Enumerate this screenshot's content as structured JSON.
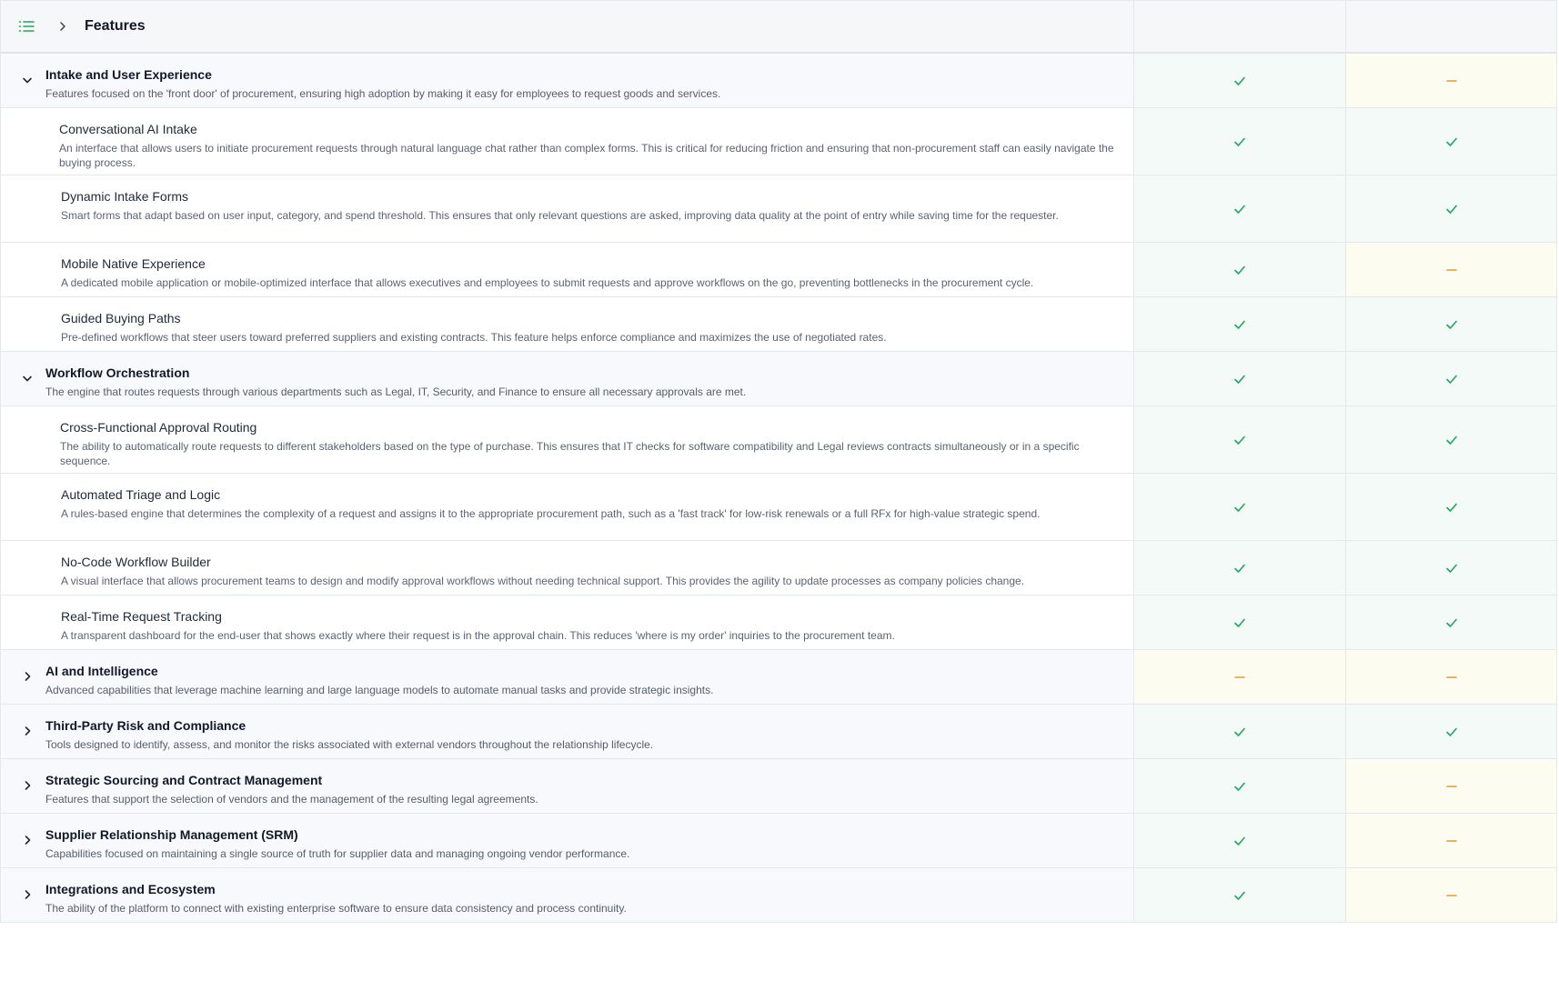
{
  "header": {
    "title": "Features"
  },
  "colors": {
    "check": "#22a55e",
    "partial": "#e89a2e",
    "yes_bg": "#f4faf7",
    "partial_bg": "#fdfcf1"
  },
  "rows": [
    {
      "kind": "group",
      "expanded": true,
      "title": "Intake and User Experience",
      "desc": "Features focused on the 'front door' of procurement, ensuring high adoption by making it easy for employees to request goods and services.",
      "a": "check",
      "b": "partial"
    },
    {
      "kind": "sub",
      "title": "Conversational AI Intake",
      "desc": "An interface that allows users to initiate procurement requests through natural language chat rather than complex forms. This is critical for reducing friction and ensuring that non-procurement staff can easily navigate the buying process.",
      "a": "check",
      "b": "check"
    },
    {
      "kind": "sub",
      "title": "Dynamic Intake Forms",
      "desc": "Smart forms that adapt based on user input, category, and spend threshold. This ensures that only relevant questions are asked, improving data quality at the point of entry while saving time for the requester.",
      "a": "check",
      "b": "check"
    },
    {
      "kind": "sub",
      "title": "Mobile Native Experience",
      "desc": "A dedicated mobile application or mobile-optimized interface that allows executives and employees to submit requests and approve workflows on the go, preventing bottlenecks in the procurement cycle.",
      "a": "check",
      "b": "partial"
    },
    {
      "kind": "sub",
      "title": "Guided Buying Paths",
      "desc": "Pre-defined workflows that steer users toward preferred suppliers and existing contracts. This feature helps enforce compliance and maximizes the use of negotiated rates.",
      "a": "check",
      "b": "check"
    },
    {
      "kind": "group",
      "expanded": true,
      "title": "Workflow Orchestration",
      "desc": "The engine that routes requests through various departments such as Legal, IT, Security, and Finance to ensure all necessary approvals are met.",
      "a": "check",
      "b": "check"
    },
    {
      "kind": "sub",
      "title": "Cross-Functional Approval Routing",
      "desc": "The ability to automatically route requests to different stakeholders based on the type of purchase. This ensures that IT checks for software compatibility and Legal reviews contracts simultaneously or in a specific sequence.",
      "a": "check",
      "b": "check"
    },
    {
      "kind": "sub",
      "title": "Automated Triage and Logic",
      "desc": "A rules-based engine that determines the complexity of a request and assigns it to the appropriate procurement path, such as a 'fast track' for low-risk renewals or a full RFx for high-value strategic spend.",
      "a": "check",
      "b": "check"
    },
    {
      "kind": "sub",
      "title": "No-Code Workflow Builder",
      "desc": "A visual interface that allows procurement teams to design and modify approval workflows without needing technical support. This provides the agility to update processes as company policies change.",
      "a": "check",
      "b": "check"
    },
    {
      "kind": "sub",
      "title": "Real-Time Request Tracking",
      "desc": "A transparent dashboard for the end-user that shows exactly where their request is in the approval chain. This reduces 'where is my order' inquiries to the procurement team.",
      "a": "check",
      "b": "check"
    },
    {
      "kind": "group",
      "expanded": false,
      "title": "AI and Intelligence",
      "desc": "Advanced capabilities that leverage machine learning and large language models to automate manual tasks and provide strategic insights.",
      "a": "partial",
      "b": "partial"
    },
    {
      "kind": "group",
      "expanded": false,
      "title": "Third-Party Risk and Compliance",
      "desc": "Tools designed to identify, assess, and monitor the risks associated with external vendors throughout the relationship lifecycle.",
      "a": "check",
      "b": "check"
    },
    {
      "kind": "group",
      "expanded": false,
      "title": "Strategic Sourcing and Contract Management",
      "desc": "Features that support the selection of vendors and the management of the resulting legal agreements.",
      "a": "check",
      "b": "partial"
    },
    {
      "kind": "group",
      "expanded": false,
      "title": "Supplier Relationship Management (SRM)",
      "desc": "Capabilities focused on maintaining a single source of truth for supplier data and managing ongoing vendor performance.",
      "a": "check",
      "b": "partial"
    },
    {
      "kind": "group",
      "expanded": false,
      "title": "Integrations and Ecosystem",
      "desc": "The ability of the platform to connect with existing enterprise software to ensure data consistency and process continuity.",
      "a": "check",
      "b": "partial"
    }
  ]
}
